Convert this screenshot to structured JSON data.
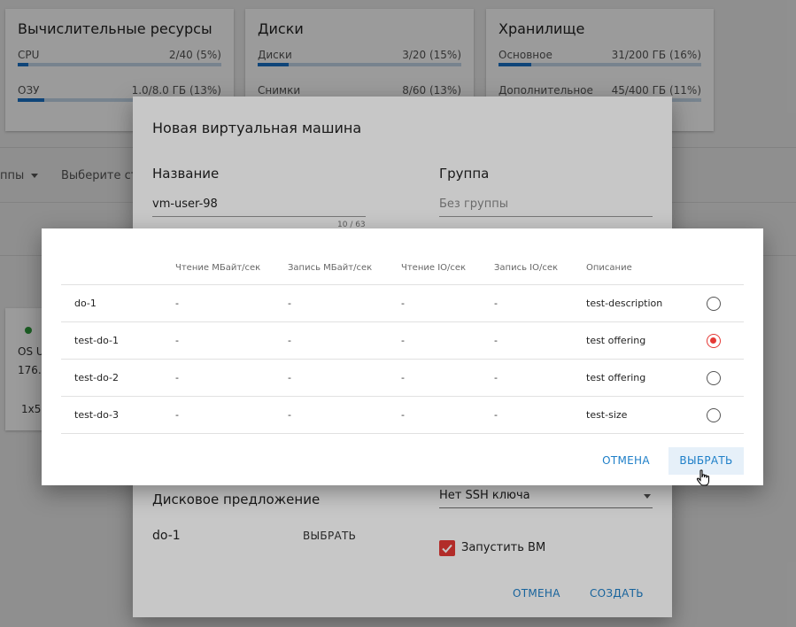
{
  "dashboard": {
    "cards": [
      {
        "title": "Вычислительные ресурсы",
        "rows": [
          {
            "label": "CPU",
            "value": "2/40 (5%)",
            "fraction": 0.05
          },
          {
            "label": "ОЗУ",
            "value": "1.0/8.0 ГБ (13%)",
            "fraction": 0.13
          }
        ]
      },
      {
        "title": "Диски",
        "rows": [
          {
            "label": "Диски",
            "value": "3/20 (15%)",
            "fraction": 0.15
          },
          {
            "label": "Снимки",
            "value": "8/60 (13%)",
            "fraction": 0.13
          }
        ]
      },
      {
        "title": "Хранилище",
        "rows": [
          {
            "label": "Основное",
            "value": "31/200 ГБ (16%)",
            "fraction": 0.16
          },
          {
            "label": "Дополнительное",
            "value": "45/400 ГБ (11%)",
            "fraction": 0.11
          }
        ]
      }
    ],
    "filters": {
      "group_fragment": "ппы",
      "state_fragment": "Выберите ст"
    },
    "vm_card": {
      "os": "OS U",
      "ip": "176.",
      "size": "1x5"
    }
  },
  "vm_dialog": {
    "title": "Новая виртуальная машина",
    "name_label": "Название",
    "name_value": "vm-user-98",
    "name_counter": "10 / 63",
    "group_label": "Группа",
    "group_placeholder": "Без группы",
    "disk_offering_label": "Дисковое предложение",
    "disk_offering_value": "do-1",
    "disk_offering_button": "ВЫБРАТЬ",
    "ssh_key_value": "Нет SSH ключа",
    "start_vm_label": "Запустить ВМ",
    "start_vm_checked": true,
    "cancel_label": "ОТМЕНА",
    "create_label": "СОЗДАТЬ"
  },
  "offering_picker": {
    "columns": [
      "",
      "Чтение МБайт/сек",
      "Запись МБайт/сек",
      "Чтение IO/сек",
      "Запись IO/сек",
      "Описание"
    ],
    "rows": [
      {
        "name": "do-1",
        "read_mb": "-",
        "write_mb": "-",
        "read_io": "-",
        "write_io": "-",
        "description": "test-description",
        "selected": false
      },
      {
        "name": "test-do-1",
        "read_mb": "-",
        "write_mb": "-",
        "read_io": "-",
        "write_io": "-",
        "description": "test offering",
        "selected": true
      },
      {
        "name": "test-do-2",
        "read_mb": "-",
        "write_mb": "-",
        "read_io": "-",
        "write_io": "-",
        "description": "test offering",
        "selected": false
      },
      {
        "name": "test-do-3",
        "read_mb": "-",
        "write_mb": "-",
        "read_io": "-",
        "write_io": "-",
        "description": "test-size",
        "selected": false
      }
    ],
    "cancel_label": "ОТМЕНА",
    "select_label": "ВЫБРАТЬ"
  },
  "colors": {
    "accent": "#1e7fc8",
    "selected": "#e53935",
    "bar_fill": "#1a73c7",
    "bar_track": "#c5d8ea"
  }
}
